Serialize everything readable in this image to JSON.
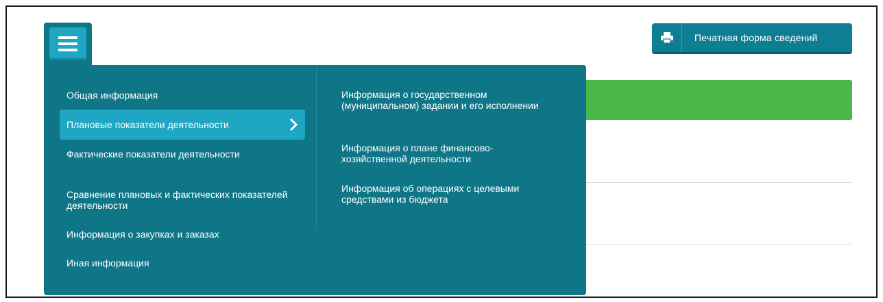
{
  "print_button": {
    "label": "Печатная форма сведений",
    "icon": "printer-icon"
  },
  "menu_button": {
    "icon": "hamburger-menu-icon"
  },
  "menu": {
    "left_items": [
      {
        "label": "Общая информация"
      },
      {
        "label": "Плановые показатели деятельности",
        "active": true
      },
      {
        "label": "Фактические показатели деятельности"
      },
      {
        "label": "Сравнение плановых и фактических показателей деятельности"
      },
      {
        "label": "Информация о закупках и заказах"
      },
      {
        "label": "Иная информация"
      }
    ],
    "right_items": [
      {
        "label": "Информация о государственном (муниципальном) задании и его исполнении"
      },
      {
        "label": "Информация о плане финансово-хозяйственной деятельности"
      },
      {
        "label": "Информация об операциях с целевыми средствами из бюджета"
      }
    ]
  },
  "colors": {
    "menu_bg": "#0f7688",
    "active_item": "#1ea6c2",
    "button": "#0e7f93",
    "success_bar": "#4cb74a"
  }
}
